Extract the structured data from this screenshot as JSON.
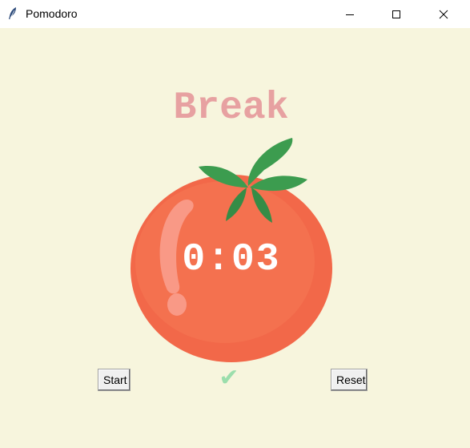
{
  "window": {
    "title": "Pomodoro",
    "icon": "feather-icon",
    "controls": {
      "minimize": "minimize-icon",
      "maximize": "maximize-icon",
      "close": "close-icon"
    }
  },
  "main": {
    "mode_label": "Break",
    "timer": "0:03",
    "checkmarks": "✔",
    "start_label": "Start",
    "reset_label": "Reset"
  },
  "colors": {
    "background": "#f7f5dd",
    "mode_label": "#e7a1a1",
    "checkmark": "#9bdeac",
    "tomato": "#f26849",
    "leaf": "#3c9c4f"
  }
}
